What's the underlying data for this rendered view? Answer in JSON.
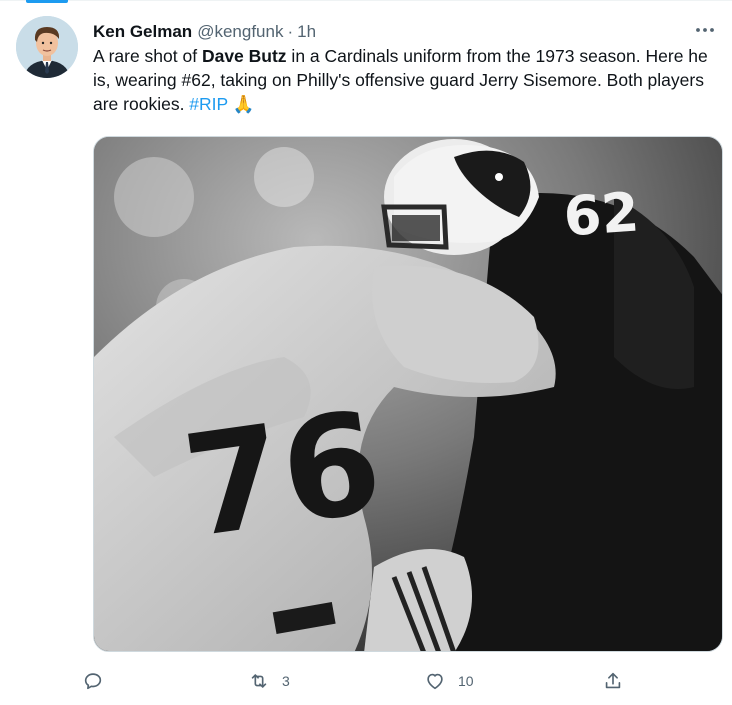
{
  "tweet": {
    "author_name": "Ken Gelman",
    "handle": "@kengfunk",
    "separator": "·",
    "time": "1h",
    "text_part1": "A rare shot of ",
    "text_bold": "Dave Butz",
    "text_part2": " in a Cardinals uniform from the 1973 season. Here he is, wearing #62, taking on Philly's offensive guard Jerry Sisemore. Both players are rookies. ",
    "hashtag": "#RIP",
    "emoji": "🙏",
    "media": {
      "jersey_number_dark": "62",
      "jersey_number_light": "76"
    },
    "actions": {
      "reply_count": "",
      "retweet_count": "3",
      "like_count": "10"
    }
  },
  "colors": {
    "accent": "#1d9bf0",
    "secondary_text": "#536471",
    "primary_text": "#0f1419"
  },
  "icons": {
    "reply": "reply-icon",
    "retweet": "retweet-icon",
    "like": "heart-icon",
    "share": "share-icon",
    "more": "more-icon"
  }
}
